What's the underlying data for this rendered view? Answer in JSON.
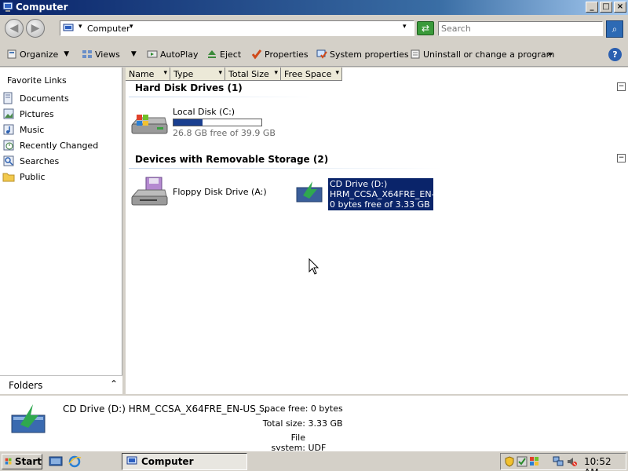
{
  "window": {
    "title": "Computer",
    "controls": [
      "_",
      "□",
      "×"
    ]
  },
  "address": {
    "back_icon": "back-arrow-icon",
    "forward_icon": "forward-arrow-icon",
    "path": "Computer",
    "search_placeholder": "Search"
  },
  "toolbar": {
    "organize": "Organize",
    "views": "Views",
    "autoplay": "AutoPlay",
    "eject": "Eject",
    "properties": "Properties",
    "system_properties": "System properties",
    "uninstall": "Uninstall or change a program",
    "more": "»",
    "help": "?"
  },
  "sidebar": {
    "heading": "Favorite Links",
    "items": [
      {
        "label": "Documents",
        "icon": "documents-icon"
      },
      {
        "label": "Pictures",
        "icon": "pictures-icon"
      },
      {
        "label": "Music",
        "icon": "music-icon"
      },
      {
        "label": "Recently Changed",
        "icon": "recently-changed-icon"
      },
      {
        "label": "Searches",
        "icon": "searches-icon"
      },
      {
        "label": "Public",
        "icon": "public-folder-icon"
      }
    ],
    "folders_label": "Folders"
  },
  "columns": [
    "Name",
    "Type",
    "Total Size",
    "Free Space"
  ],
  "groups": {
    "hard_disks": {
      "title": "Hard Disk Drives (1)",
      "drives": [
        {
          "name": "Local Disk (C:)",
          "free_text": "26.8 GB free of 39.9 GB",
          "used_fraction": 0.33
        }
      ]
    },
    "removable": {
      "title": "Devices with Removable Storage (2)",
      "floppy": {
        "name": "Floppy Disk Drive (A:)"
      },
      "cd": {
        "name": "CD Drive (D:)",
        "label": "HRM_CCSA_X64FRE_EN-...",
        "free_text": "0 bytes free of 3.33 GB"
      }
    }
  },
  "details": {
    "name": "CD Drive (D:) HRM_CCSA_X64FRE_EN-US_...",
    "space_free_label": "Space free:",
    "space_free": "0 bytes",
    "total_size_label": "Total size:",
    "total_size": "3.33 GB",
    "file_system_label": "File system:",
    "file_system": "UDF"
  },
  "taskbar": {
    "start": "Start",
    "task": "Computer",
    "clock": "10:52 AM"
  },
  "colors": {
    "selection": "#0a246a",
    "title_gradient_start": "#0a246a"
  }
}
